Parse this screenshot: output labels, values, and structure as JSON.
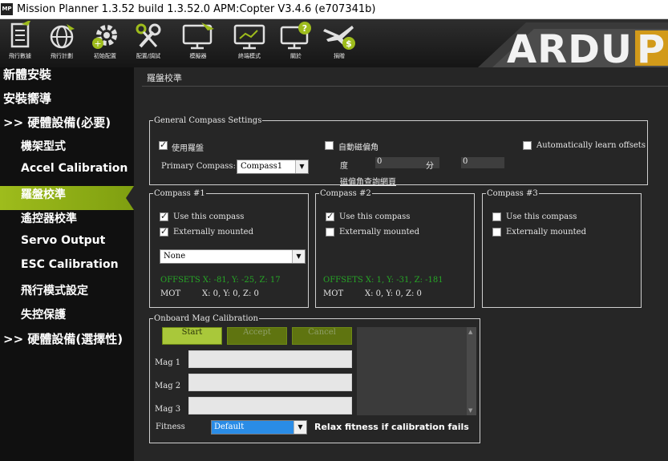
{
  "window": {
    "app_icon": "MP",
    "title": "Mission Planner 1.3.52 build 1.3.52.0 APM:Copter V3.4.6 (e707341b)"
  },
  "toolbar": [
    {
      "label": "飛行數據",
      "icon": "flight-data-icon"
    },
    {
      "label": "飛行計劃",
      "icon": "flight-plan-icon"
    },
    {
      "label": "初始配置",
      "icon": "initial-setup-icon"
    },
    {
      "label": "配置/調試",
      "icon": "config-tuning-icon"
    },
    {
      "label": "模擬器",
      "icon": "simulation-icon"
    },
    {
      "label": "終端模式",
      "icon": "terminal-icon"
    },
    {
      "label": "關於",
      "icon": "help-icon"
    },
    {
      "label": "捐贈",
      "icon": "donate-icon"
    }
  ],
  "brand": {
    "logo_text": "ARDUP"
  },
  "sidebar": [
    {
      "label": "新體安裝",
      "sub": false,
      "active": false
    },
    {
      "label": "安裝嚮導",
      "sub": false,
      "active": false
    },
    {
      "label": ">> 硬體設備(必要)",
      "sub": false,
      "active": false
    },
    {
      "label": "機架型式",
      "sub": true,
      "active": false
    },
    {
      "label": "Accel Calibration",
      "sub": true,
      "active": false
    },
    {
      "label": "羅盤校準",
      "sub": true,
      "active": true
    },
    {
      "label": "遙控器校準",
      "sub": true,
      "active": false
    },
    {
      "label": "Servo Output",
      "sub": true,
      "active": false
    },
    {
      "label": "ESC Calibration",
      "sub": true,
      "active": false
    },
    {
      "label": "飛行模式設定",
      "sub": true,
      "active": false
    },
    {
      "label": "失控保護",
      "sub": true,
      "active": false
    },
    {
      "label": ">> 硬體設備(選擇性)",
      "sub": false,
      "active": false
    }
  ],
  "page_header": "羅盤校準",
  "general": {
    "legend": "General Compass Settings",
    "use_compass_label": "使用羅盤",
    "use_compass_checked": true,
    "primary_label": "Primary Compass:",
    "primary_value": "Compass1",
    "declination_label": "自動磁偏角",
    "declination_checked": false,
    "degree_label": "度",
    "degree_value": "0",
    "minute_label": "分",
    "minute_value": "0",
    "decl_link": "磁偏角查詢網頁",
    "learn_label": "Automatically learn offsets",
    "learn_checked": false
  },
  "compasses": [
    {
      "legend": "Compass #1",
      "use_label": "Use this compass",
      "use_checked": true,
      "ext_label": "Externally mounted",
      "ext_checked": true,
      "orientation": "None",
      "offsets": "OFFSETS  X: -81,   Y: -25,   Z: 17",
      "mot_label": "MOT",
      "mot": "X: 0,   Y: 0,   Z: 0"
    },
    {
      "legend": "Compass #2",
      "use_label": "Use this compass",
      "use_checked": true,
      "ext_label": "Externally mounted",
      "ext_checked": false,
      "offsets": "OFFSETS  X: 1,    Y: -31,   Z: -181",
      "mot_label": "MOT",
      "mot": "X: 0,   Y: 0,   Z: 0"
    },
    {
      "legend": "Compass #3",
      "use_label": "Use this compass",
      "use_checked": false,
      "ext_label": "Externally mounted",
      "ext_checked": false
    }
  ],
  "onboard": {
    "legend": "Onboard Mag Calibration",
    "start": "Start",
    "accept": "Accept",
    "cancel": "Cancel",
    "mag1": "Mag 1",
    "mag2": "Mag 2",
    "mag3": "Mag 3",
    "fitness_label": "Fitness",
    "fitness_value": "Default",
    "relax_label": "Relax fitness if calibration fails"
  },
  "colors": {
    "accent": "#9ebc1c",
    "offsets_text": "#26a626",
    "sidebar_bg": "#101010",
    "panel_bg": "#262626"
  }
}
